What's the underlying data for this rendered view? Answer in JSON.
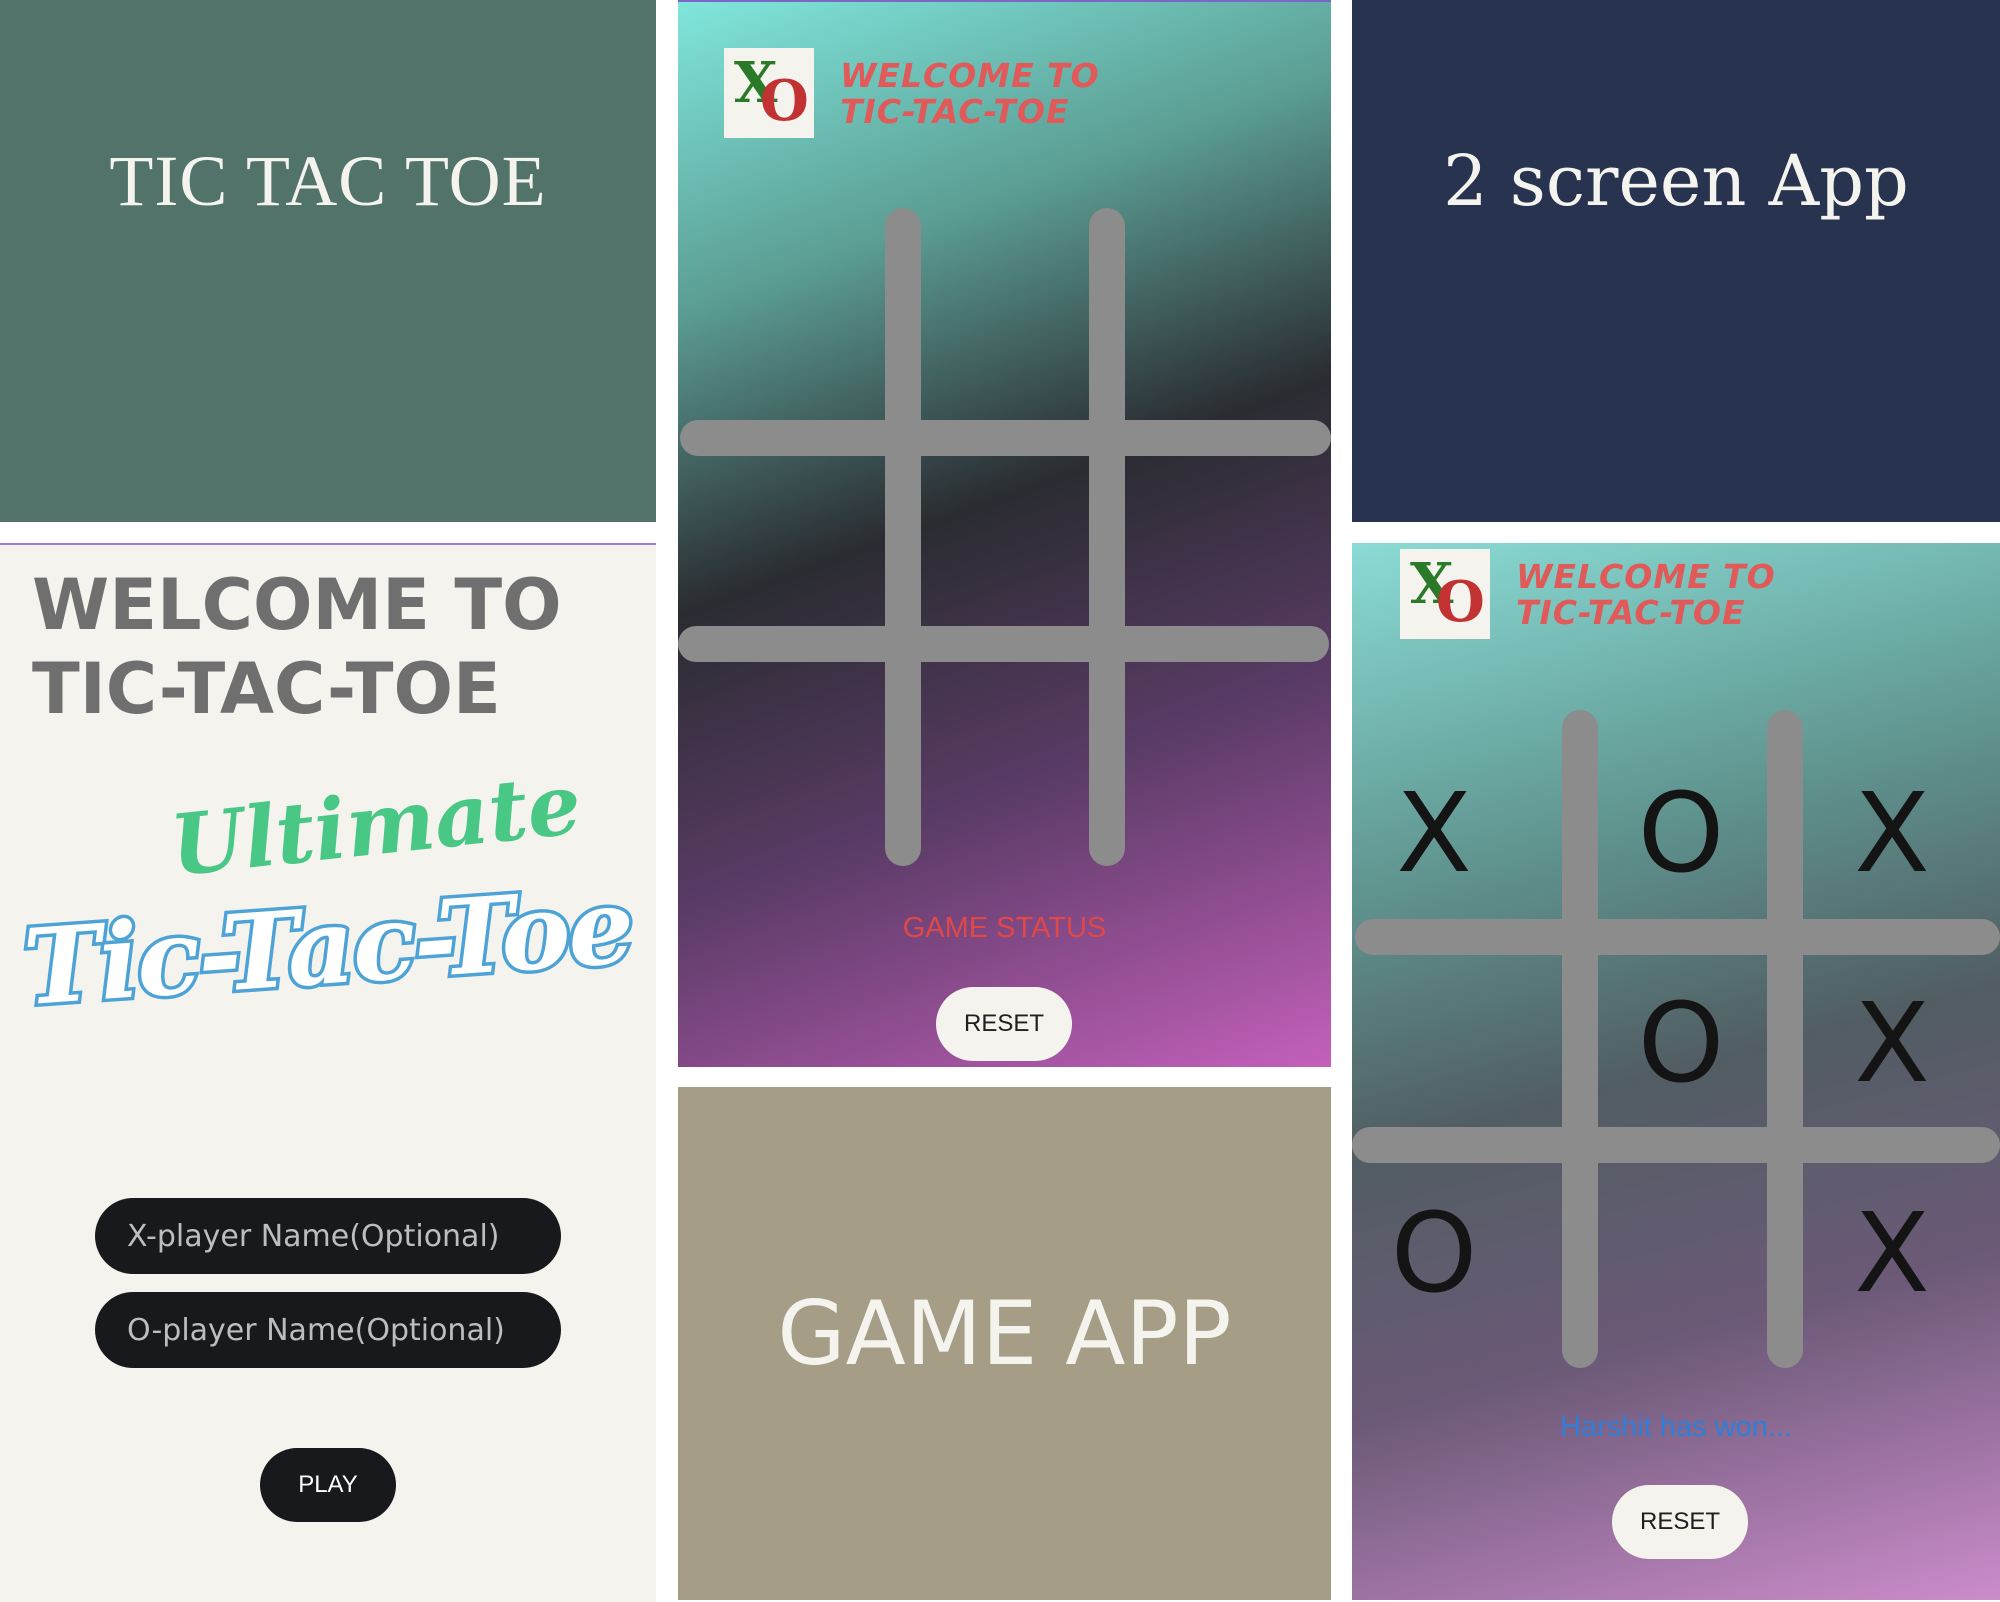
{
  "tiles": {
    "title_tile": "TIC TAC TOE",
    "app_tile": "2 screen App",
    "game_app_tile": "GAME APP"
  },
  "welcome_screen": {
    "title_line1": "WELCOME TO",
    "title_line2": "TIC-TAC-TOE",
    "logo_top": "Ultimate",
    "logo_main": "Tic-Tac-Toe",
    "x_player_placeholder": "X-player Name(Optional)",
    "o_player_placeholder": "O-player Name(Optional)",
    "play_label": "PLAY"
  },
  "game_screen_empty": {
    "banner_line1": "WELCOME TO",
    "banner_line2": "TIC-TAC-TOE",
    "logo_x": "X",
    "logo_o": "O",
    "status": "GAME STATUS",
    "status_color": "#e04848",
    "reset_label": "RESET"
  },
  "game_screen_finished": {
    "banner_line1": "WELCOME TO",
    "banner_line2": "TIC-TAC-TOE",
    "logo_x": "X",
    "logo_o": "O",
    "board": [
      "X",
      "O",
      "X",
      "",
      "O",
      "X",
      "O",
      "",
      "X"
    ],
    "status": "Harshit  has won...",
    "status_color": "#2f7fd8",
    "reset_label": "RESET"
  },
  "colors": {
    "title_tile_bg": "#51736a",
    "app_tile_bg": "#28344f",
    "game_app_tile_bg": "#a69d86",
    "welcome_bg": "#f4f3ee",
    "grid_line": "#8c8c8c"
  }
}
